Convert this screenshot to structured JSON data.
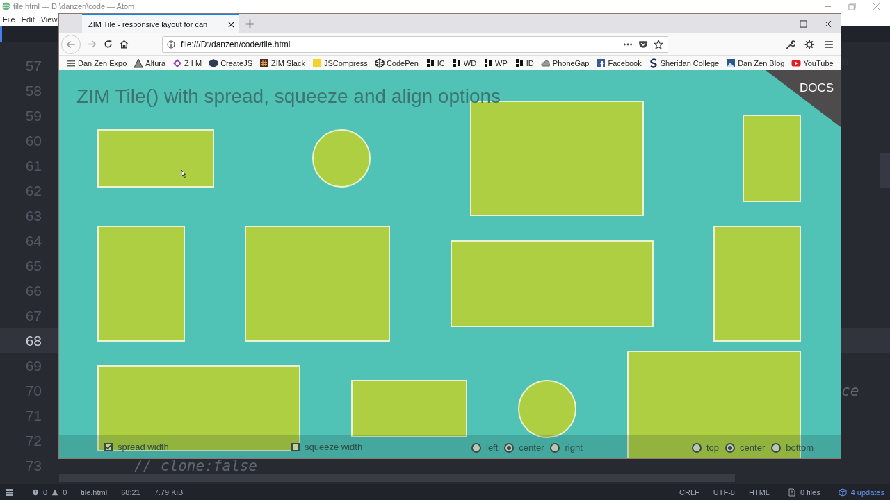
{
  "editor_window": {
    "title": "tile.html — D:\\danzen\\code — Atom",
    "menu": [
      "File",
      "Edit",
      "View"
    ]
  },
  "code_lines": [
    {
      "number": "57",
      "current": false
    },
    {
      "number": "58",
      "current": false
    },
    {
      "number": "59",
      "current": false
    },
    {
      "number": "60",
      "current": false
    },
    {
      "number": "61",
      "current": false
    },
    {
      "number": "62",
      "current": false
    },
    {
      "number": "63",
      "current": false
    },
    {
      "number": "64",
      "current": false
    },
    {
      "number": "65",
      "current": false
    },
    {
      "number": "66",
      "current": false
    },
    {
      "number": "67",
      "current": false
    },
    {
      "number": "68",
      "current": true
    },
    {
      "number": "69",
      "current": false
    },
    {
      "number": "70",
      "current": false,
      "kind": "clipped",
      "text": "ce"
    },
    {
      "number": "71",
      "current": false
    },
    {
      "number": "72",
      "current": false
    },
    {
      "number": "73",
      "current": false,
      "kind": "code",
      "text": "// clone:false"
    }
  ],
  "status_bar": {
    "errors": "0",
    "warnings": "0",
    "file": "tile.html",
    "cursor": "68:21",
    "size": "7.79 KiB",
    "line_ending": "CRLF",
    "encoding": "UTF-8",
    "grammar": "HTML",
    "git": "0 files",
    "updates": "4 updates"
  },
  "browser": {
    "tabs": [
      {
        "label": "ZIM Tile - responsive layout for can",
        "selected": true
      }
    ],
    "url": "file:///D:/danzen/code/tile.html",
    "bookmarks": [
      "Dan Zen Expo",
      "Altura",
      "Z I M",
      "CreateJS",
      "ZIM Slack",
      "JSCompress",
      "CodePen",
      "IC",
      "WD",
      "WP",
      "ID",
      "PhoneGap",
      "Facebook",
      "Sheridan College",
      "Dan Zen Blog",
      "YouTube"
    ],
    "page": {
      "title": "ZIM Tile() with spread, squeeze and align options",
      "docs": "DOCS",
      "shapes": [
        {
          "kind": "rect"
        },
        {
          "kind": "circle"
        },
        {
          "kind": "rect"
        },
        {
          "kind": "rect"
        },
        {
          "kind": "rect"
        },
        {
          "kind": "rect"
        },
        {
          "kind": "rect"
        },
        {
          "kind": "rect"
        },
        {
          "kind": "rect"
        },
        {
          "kind": "rect"
        },
        {
          "kind": "circle"
        },
        {
          "kind": "rect"
        }
      ],
      "checkboxes": [
        {
          "label": "spread width",
          "checked": true
        },
        {
          "label": "squeeze width",
          "checked": false
        }
      ],
      "radio_groups": [
        [
          {
            "label": "left",
            "selected": false
          },
          {
            "label": "center",
            "selected": true
          },
          {
            "label": "right",
            "selected": false
          }
        ],
        [
          {
            "label": "top",
            "selected": false
          },
          {
            "label": "center",
            "selected": true
          },
          {
            "label": "bottom",
            "selected": false
          }
        ]
      ]
    }
  }
}
